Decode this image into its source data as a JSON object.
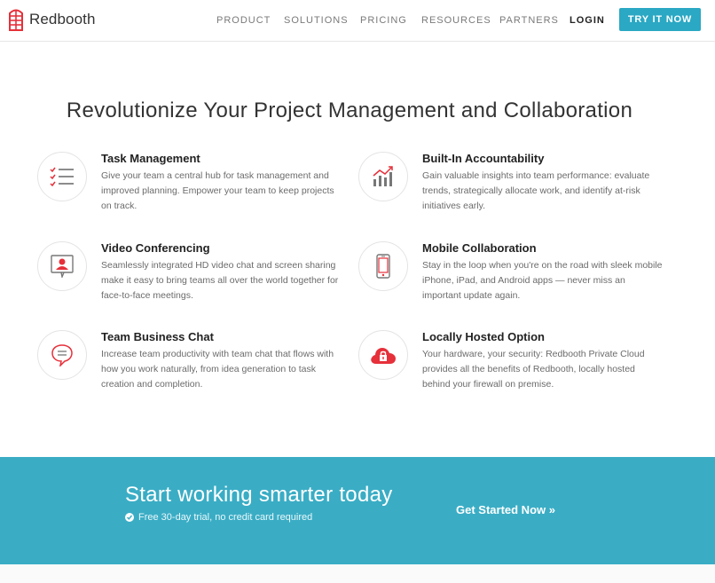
{
  "brand": {
    "name": "Redbooth",
    "color": "#e6303a"
  },
  "nav": {
    "items": [
      "PRODUCT",
      "SOLUTIONS",
      "PRICING",
      "RESOURCES",
      "PARTNERS"
    ],
    "login": "LOGIN",
    "cta": "TRY IT NOW"
  },
  "main": {
    "title": "Revolutionize Your Project Management and Collaboration"
  },
  "features": [
    {
      "icon": "checklist-icon",
      "title": "Task Management",
      "desc": "Give your team a central hub for task management and improved planning. Empower your team to keep projects on track."
    },
    {
      "icon": "bar-chart-icon",
      "title": "Built-In Accountability",
      "desc": "Gain valuable insights into team performance: evaluate trends, strategically allocate work, and identify at-risk initiatives early."
    },
    {
      "icon": "video-chat-icon",
      "title": "Video Conferencing",
      "desc": "Seamlessly integrated HD video chat and screen sharing make it easy to bring teams all over the world together for face-to-face meetings."
    },
    {
      "icon": "mobile-phone-icon",
      "title": "Mobile Collaboration",
      "desc": "Stay in the loop when you're on the road with sleek mobile iPhone, iPad, and Android apps — never miss an important update again."
    },
    {
      "icon": "chat-bubble-icon",
      "title": "Team Business Chat",
      "desc": "Increase team productivity with team chat that flows with how you work naturally, from idea generation to task creation and completion."
    },
    {
      "icon": "cloud-lock-icon",
      "title": "Locally Hosted Option",
      "desc": "Your hardware, your security: Redbooth Private Cloud provides all the benefits of Redbooth, locally hosted behind your firewall on premise."
    }
  ],
  "cta_band": {
    "title": "Start working smarter today",
    "subtitle": "Free 30-day trial, no credit card required",
    "link": "Get Started Now »",
    "background": "#3aadc5"
  },
  "colors": {
    "accent": "#2aa8c4",
    "icon_red": "#e6303a"
  }
}
